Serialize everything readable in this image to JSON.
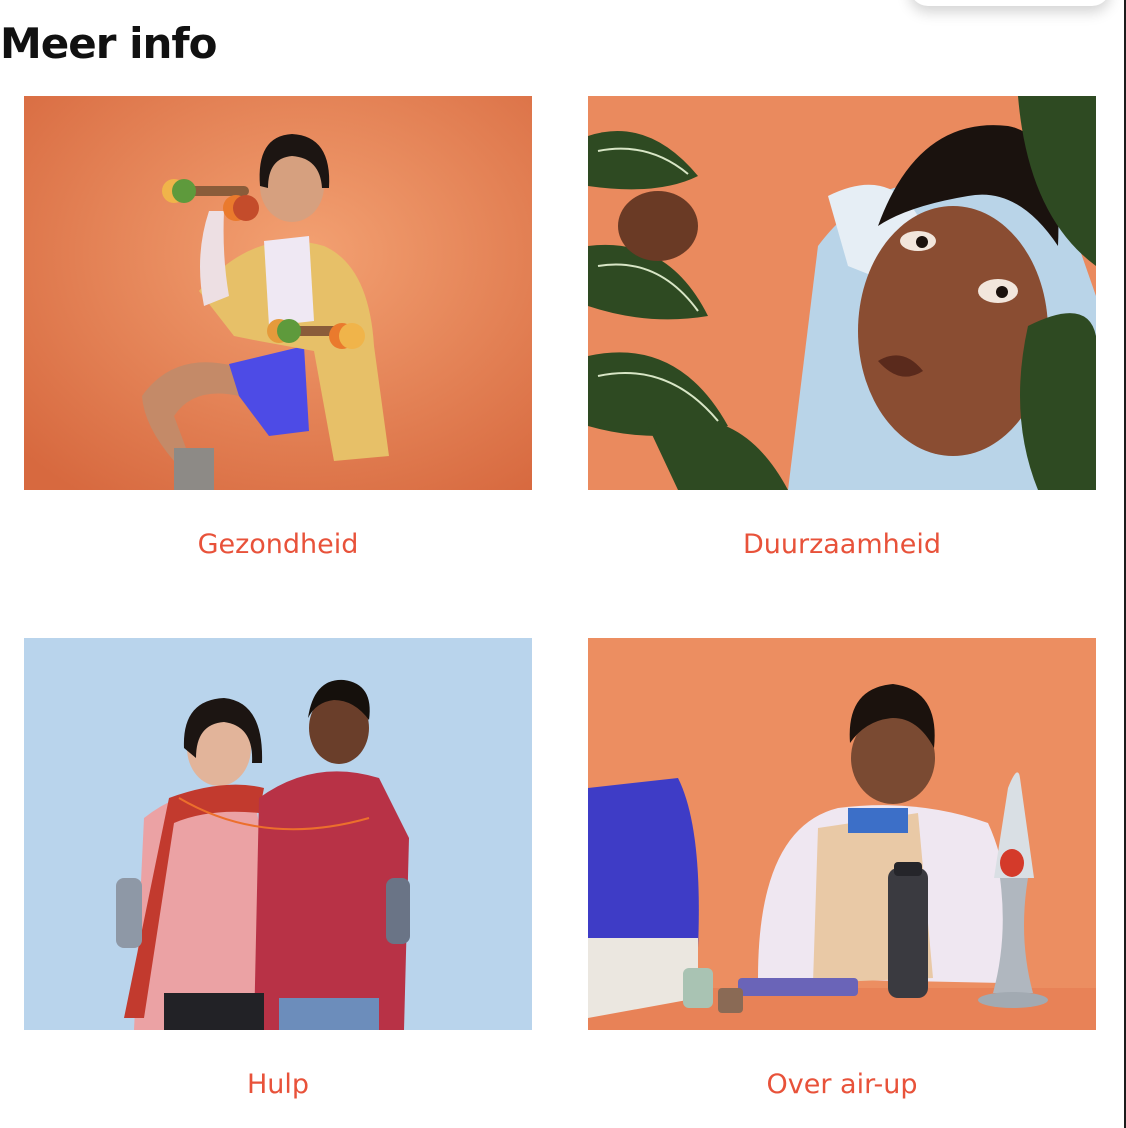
{
  "section": {
    "title": "Meer info"
  },
  "cards": [
    {
      "label": "Gezondheid",
      "image_subject": "person posing with fruit dumbbells on orange background"
    },
    {
      "label": "Duurzaamheid",
      "image_subject": "person peeking through green plants on orange background"
    },
    {
      "label": "Hulp",
      "image_subject": "two people back to back on a tin-can phone on light blue background"
    },
    {
      "label": "Over air-up",
      "image_subject": "person at a computer drinking from an air-up bottle with lava lamp on orange background"
    }
  ],
  "colors": {
    "link_text": "#e8523a",
    "heading_text": "#111111",
    "orange_backdrop": "#e98a5c",
    "blue_backdrop": "#b8d3ea"
  }
}
